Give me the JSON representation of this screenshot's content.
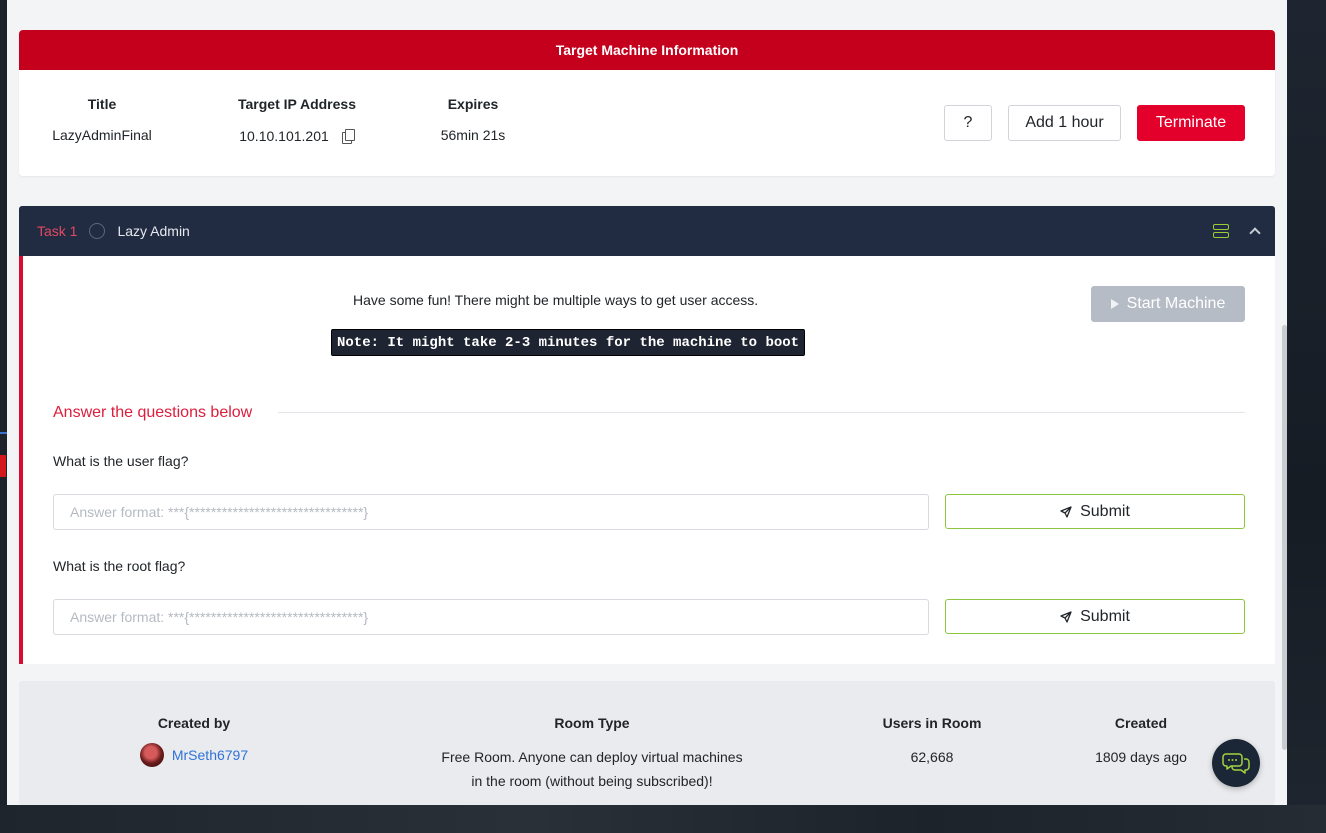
{
  "target_machine": {
    "header": "Target Machine Information",
    "title_label": "Title",
    "title_value": "LazyAdminFinal",
    "ip_label": "Target IP Address",
    "ip_value": "10.10.101.201",
    "expires_label": "Expires",
    "expires_value": "56min 21s",
    "help_label": "?",
    "add_hour_label": "Add 1 hour",
    "terminate_label": "Terminate"
  },
  "task": {
    "number": "Task 1",
    "title": "Lazy Admin",
    "description": "Have some fun! There might be multiple ways to get user access.",
    "note": "Note: It might take 2-3 minutes for the machine to boot",
    "start_label": "Start Machine",
    "answer_heading": "Answer the questions below",
    "questions": [
      {
        "text": "What is the user flag?",
        "placeholder": "Answer format: ***{********************************}",
        "submit_label": "Submit"
      },
      {
        "text": "What is the root flag?",
        "placeholder": "Answer format: ***{********************************}",
        "submit_label": "Submit"
      }
    ]
  },
  "room_info": {
    "created_by_label": "Created by",
    "creator_name": "MrSeth6797",
    "room_type_label": "Room Type",
    "room_type_line1": "Free Room. Anyone can deploy virtual machines",
    "room_type_line2": "in the room (without being subscribed)!",
    "users_label": "Users in Room",
    "users_value": "62,668",
    "created_label": "Created",
    "created_value": "1809 days ago"
  },
  "colors": {
    "brand_red": "#c4001d",
    "terminate_red": "#e3002b",
    "task_header": "#212c42",
    "submit_border": "#8cc63f",
    "link_blue": "#2f73d8"
  },
  "icons": {
    "copy": "copy-icon",
    "server": "server-icon",
    "chevron": "chevron-up-icon",
    "play": "play-icon",
    "send": "send-icon",
    "chat": "chat-icon"
  }
}
